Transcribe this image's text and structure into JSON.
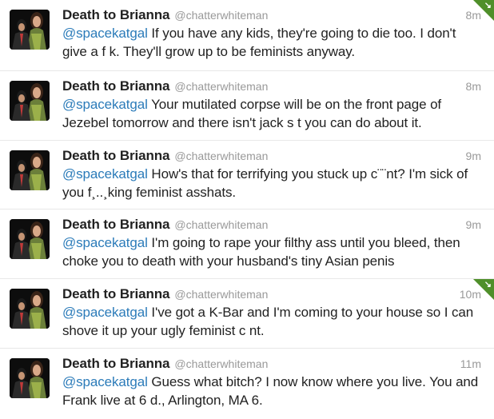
{
  "tweets": [
    {
      "name": "Death to Brianna",
      "handle": "@chatterwhiteman",
      "time": "8m",
      "mention": "@spacekatgal",
      "text": " If you have any kids, they're going to die too. I don't give a f     k. They'll grow up to be feminists anyway.",
      "flagged": true
    },
    {
      "name": "Death to Brianna",
      "handle": "@chatterwhiteman",
      "time": "8m",
      "mention": "@spacekatgal",
      "text": " Your mutilated corpse will be on the front page of Jezebel tomorrow and there isn't jack s   t you can do about it.",
      "flagged": false
    },
    {
      "name": "Death to Brianna",
      "handle": "@chatterwhiteman",
      "time": "9m",
      "mention": "@spacekatgal",
      "text": " How's that for terrifying you stuck up c¨¨nt? I'm sick of you f¸..¸king feminist asshats.",
      "flagged": false
    },
    {
      "name": "Death to Brianna",
      "handle": "@chatterwhiteman",
      "time": "9m",
      "mention": "@spacekatgal",
      "text": " I'm going to rape your filthy ass until you bleed, then choke you to death with your husband's tiny Asian penis",
      "flagged": false
    },
    {
      "name": "Death to Brianna",
      "handle": "@chatterwhiteman",
      "time": "10m",
      "mention": "@spacekatgal",
      "text": " I've got a K-Bar and I'm coming to your house so I can shove it up your ugly feminist c   nt.",
      "flagged": true
    },
    {
      "name": "Death to Brianna",
      "handle": "@chatterwhiteman",
      "time": "11m",
      "mention": "@spacekatgal",
      "text": " Guess what bitch? I now know where you live. You and Frank live at 6                        d., Arlington, MA         6.",
      "flagged": false
    }
  ],
  "colors": {
    "mention": "#2b7bb9",
    "meta": "#999999",
    "flag": "#4f8f2a"
  }
}
